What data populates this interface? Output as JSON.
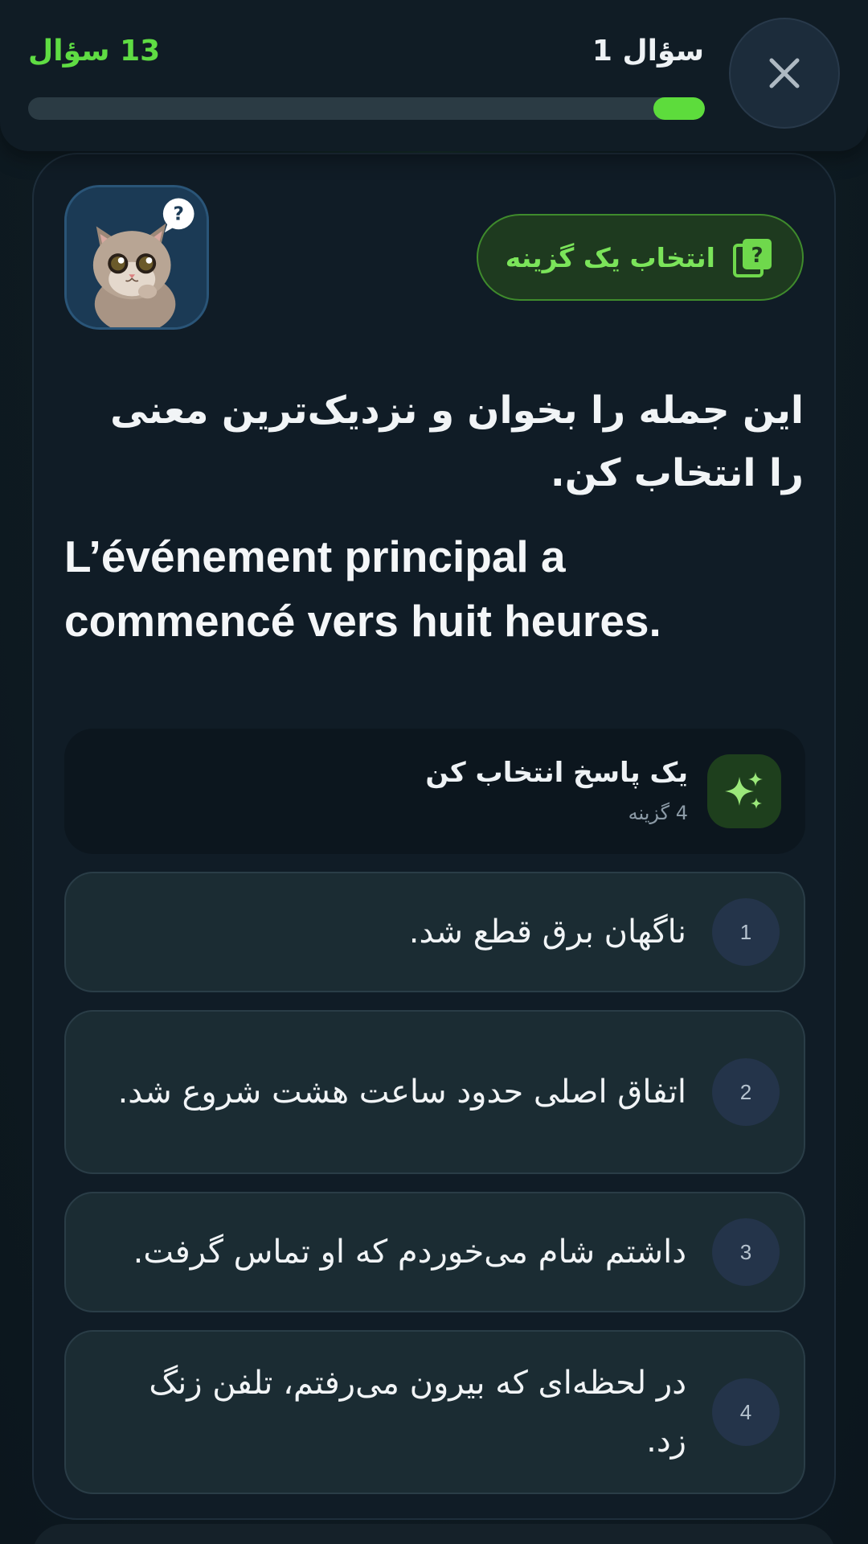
{
  "header": {
    "question_label": "سؤال 1",
    "total_label": "13 سؤال",
    "progress_fraction": 0.076,
    "accent_color": "#5ddc3c"
  },
  "mode": {
    "label": "انتخاب یک گزینه",
    "icon": "question-card-icon"
  },
  "prompt": {
    "instruction": "این جمله را بخوان و نزدیک‌ترین معنی را انتخاب کن.",
    "sentence": "L’événement principal a commencé vers huit heures."
  },
  "answers": {
    "title": "یک پاسخ انتخاب کن",
    "count": "4 گزینه",
    "icon": "sparkles-icon"
  },
  "options": [
    {
      "number": "1",
      "text": "ناگهان برق قطع شد."
    },
    {
      "number": "2",
      "text": "اتفاق اصلی حدود ساعت هشت شروع شد."
    },
    {
      "number": "3",
      "text": "داشتم شام می‌خوردم که او تماس گرفت."
    },
    {
      "number": "4",
      "text": "در لحظه‌ای که بیرون می‌رفتم، تلفن زنگ زد."
    }
  ]
}
